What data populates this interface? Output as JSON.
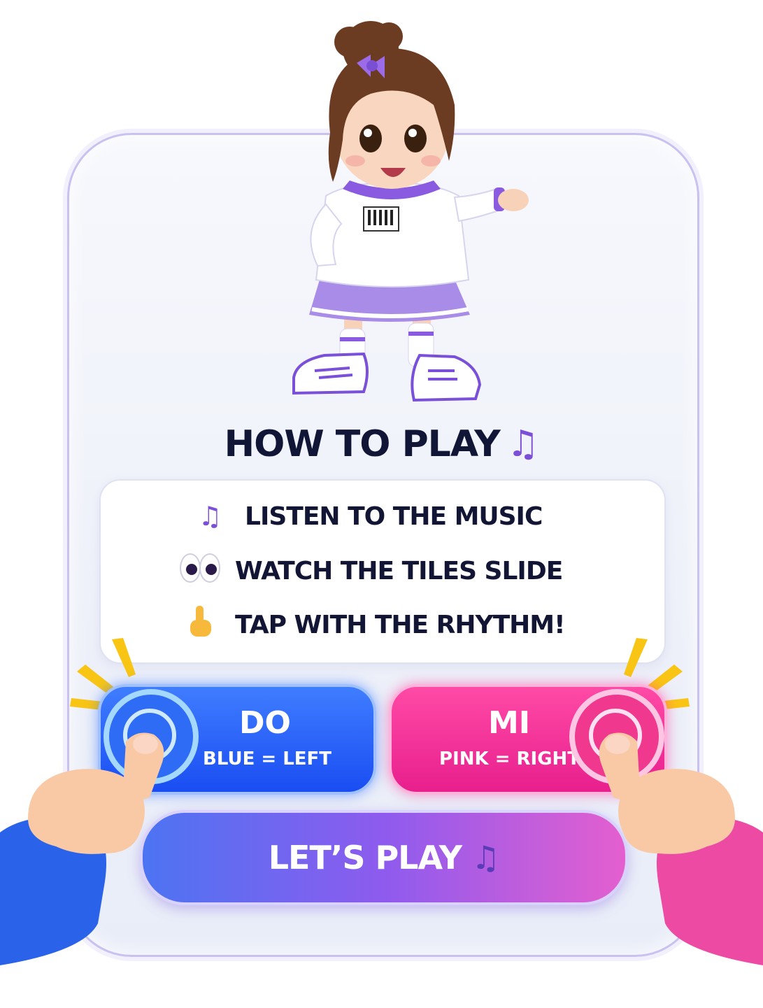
{
  "title": {
    "text": "HOW TO PLAY",
    "icon": "music-note-icon"
  },
  "instructions": [
    {
      "icon": "music-note-icon",
      "text": "LISTEN TO THE MUSIC"
    },
    {
      "icon": "eyes-icon",
      "text": "WATCH THE TILES SLIDE"
    },
    {
      "icon": "pointing-finger-icon",
      "text": "TAP WITH THE RHYTHM!"
    }
  ],
  "keys": {
    "left": {
      "note": "DO",
      "hint": "BLUE = LEFT",
      "color": "#1f55f5"
    },
    "right": {
      "note": "MI",
      "hint": "PINK = RIGHT",
      "color": "#ee2a94"
    }
  },
  "play_button": {
    "label": "LET’S PLAY",
    "icon": "music-note-icon"
  },
  "glyphs": {
    "note": "♫",
    "eyes": "👀",
    "finger": "👆"
  },
  "colors": {
    "accent": "#7b4fd6",
    "title": "#111536",
    "blue": "#1f55f5",
    "pink": "#ee2a94"
  }
}
